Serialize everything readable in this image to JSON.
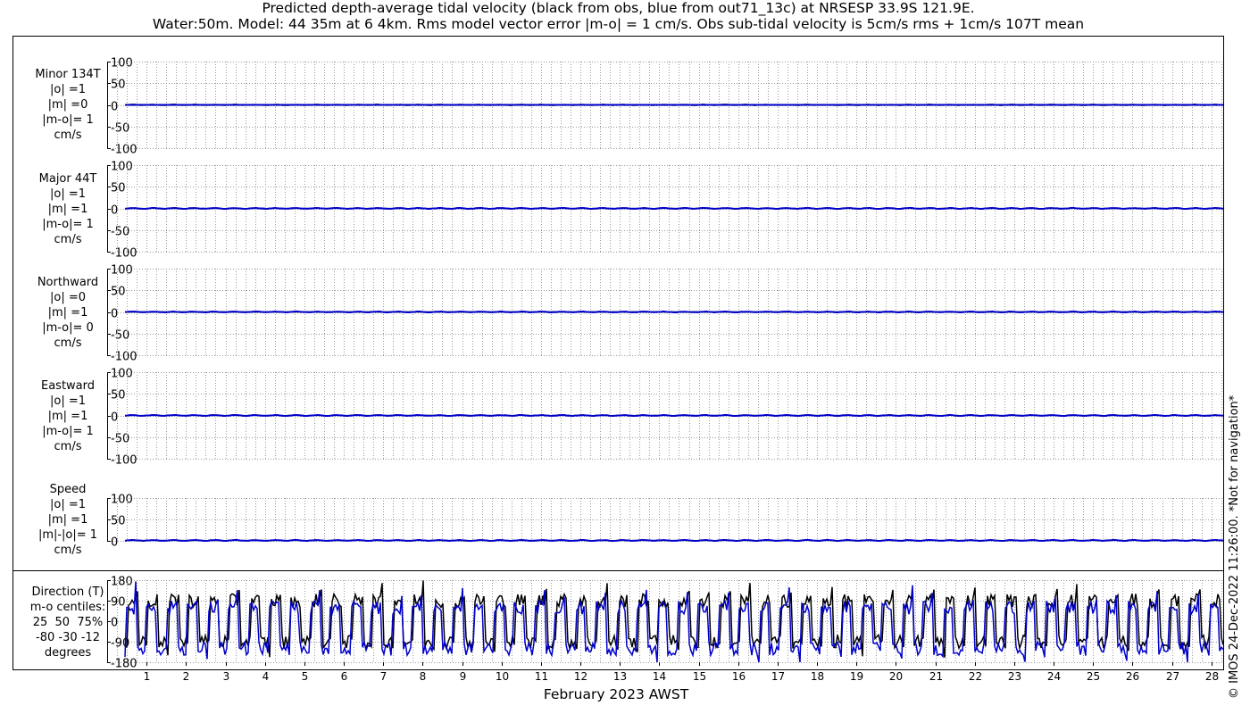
{
  "title_line1": "Predicted depth-average tidal velocity (black from obs, blue from out71_13c) at NRSESP 33.9S 121.9E.",
  "title_line2": "Water:50m. Model: 44 35m at 6 4km. Rms model vector error |m-o| = 1 cm/s. Obs sub-tidal velocity is 5cm/s rms + 1cm/s 107T mean",
  "xlabel": "February 2023 AWST",
  "credit": "© IMOS 24-Dec-2022 11:26:00.  *Not for navigation*",
  "colors": {
    "obs": "#000000",
    "model": "#0000cc",
    "grid": "#9a9a9a"
  },
  "chart_data": {
    "type": "line",
    "x_label": "February 2023 AWST",
    "x_ticks": [
      "1",
      "2",
      "3",
      "4",
      "5",
      "6",
      "7",
      "8",
      "9",
      "10",
      "11",
      "12",
      "13",
      "14",
      "15",
      "16",
      "17",
      "18",
      "19",
      "20",
      "21",
      "22",
      "23",
      "24",
      "25",
      "26",
      "27",
      "28"
    ],
    "x_range_days": [
      0,
      28.3
    ],
    "panels": [
      {
        "id": "minor",
        "label": "Minor 134T\n|o| =1\n|m| =0\n|m-o|= 1\ncm/s",
        "ylim": [
          -100,
          100
        ],
        "yticks": [
          "100",
          "50",
          "0",
          "-50",
          "-100"
        ],
        "ytick_values": [
          100,
          50,
          0,
          -50,
          -100
        ],
        "series": [
          {
            "name": "obs",
            "level": 0,
            "amplitude": 1
          },
          {
            "name": "model",
            "level": 0,
            "amplitude": 0
          }
        ]
      },
      {
        "id": "major",
        "label": "Major 44T\n|o| =1\n|m| =1\n|m-o|= 1\ncm/s",
        "ylim": [
          -100,
          100
        ],
        "yticks": [
          "100",
          "50",
          "0",
          "-50",
          "-100"
        ],
        "ytick_values": [
          100,
          50,
          0,
          -50,
          -100
        ],
        "series": [
          {
            "name": "obs",
            "level": 0,
            "amplitude": 1
          },
          {
            "name": "model",
            "level": 0,
            "amplitude": 1
          }
        ]
      },
      {
        "id": "northward",
        "label": "Northward\n|o| =0\n|m| =1\n|m-o|= 0\ncm/s",
        "ylim": [
          -100,
          100
        ],
        "yticks": [
          "100",
          "50",
          "0",
          "-50",
          "-100"
        ],
        "ytick_values": [
          100,
          50,
          0,
          -50,
          -100
        ],
        "series": [
          {
            "name": "obs",
            "level": 0,
            "amplitude": 0
          },
          {
            "name": "model",
            "level": 0,
            "amplitude": 1
          }
        ]
      },
      {
        "id": "eastward",
        "label": "Eastward\n|o| =1\n|m| =1\n|m-o|= 1\ncm/s",
        "ylim": [
          -100,
          100
        ],
        "yticks": [
          "100",
          "50",
          "0",
          "-50",
          "-100"
        ],
        "ytick_values": [
          100,
          50,
          0,
          -50,
          -100
        ],
        "series": [
          {
            "name": "obs",
            "level": 0,
            "amplitude": 1
          },
          {
            "name": "model",
            "level": 0,
            "amplitude": 1
          }
        ]
      },
      {
        "id": "speed",
        "label": "Speed\n|o| =1\n|m| =1\n|m|-|o|= 1\ncm/s",
        "ylim": [
          0,
          100
        ],
        "yticks": [
          "100",
          "50",
          "0"
        ],
        "ytick_values": [
          100,
          50,
          0
        ],
        "series": [
          {
            "name": "obs",
            "level": 1,
            "amplitude": 1
          },
          {
            "name": "model",
            "level": 1,
            "amplitude": 1
          }
        ]
      },
      {
        "id": "direction",
        "label": "Direction (T)\nm-o centiles:\n25  50  75%\n-80 -30 -12\ndegrees",
        "ylim": [
          -180,
          180
        ],
        "yticks": [
          "180",
          "90",
          "0",
          "-90",
          "-180"
        ],
        "ytick_values": [
          180,
          90,
          0,
          -90,
          -180
        ],
        "series": [
          {
            "name": "obs",
            "mean_high": 90,
            "mean_low": -90
          },
          {
            "name": "model",
            "mean_high": 60,
            "mean_low": -120
          }
        ]
      }
    ]
  }
}
